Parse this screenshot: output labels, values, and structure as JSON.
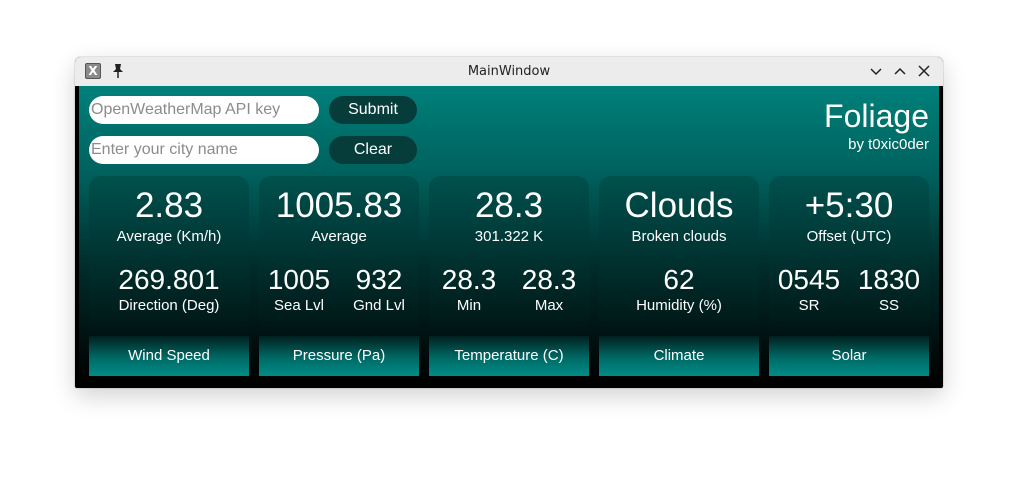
{
  "window": {
    "title": "MainWindow"
  },
  "form": {
    "api_placeholder": "OpenWeatherMap API key",
    "city_placeholder": "Enter your city name",
    "submit_label": "Submit",
    "clear_label": "Clear"
  },
  "brand": {
    "name": "Foliage",
    "author": "by t0xic0der"
  },
  "cards": {
    "wind": {
      "value": "2.83",
      "value_label": "Average (Km/h)",
      "direction": "269.801",
      "direction_label": "Direction (Deg)",
      "title": "Wind Speed"
    },
    "pressure": {
      "value": "1005.83",
      "value_label": "Average",
      "sea": "1005",
      "sea_label": "Sea Lvl",
      "ground": "932",
      "ground_label": "Gnd Lvl",
      "title": "Pressure (Pa)"
    },
    "temperature": {
      "value": "28.3",
      "value_label": "301.322 K",
      "min": "28.3",
      "min_label": "Min",
      "max": "28.3",
      "max_label": "Max",
      "title": "Temperature (C)"
    },
    "climate": {
      "value": "Clouds",
      "value_label": "Broken clouds",
      "humidity": "62",
      "humidity_label": "Humidity (%)",
      "title": "Climate"
    },
    "solar": {
      "value": "+5:30",
      "value_label": "Offset (UTC)",
      "sunrise": "0545",
      "sunrise_label": "SR",
      "sunset": "1830",
      "sunset_label": "SS",
      "title": "Solar"
    }
  },
  "colors": {
    "accent": "#008c86",
    "button": "#063d3b"
  }
}
